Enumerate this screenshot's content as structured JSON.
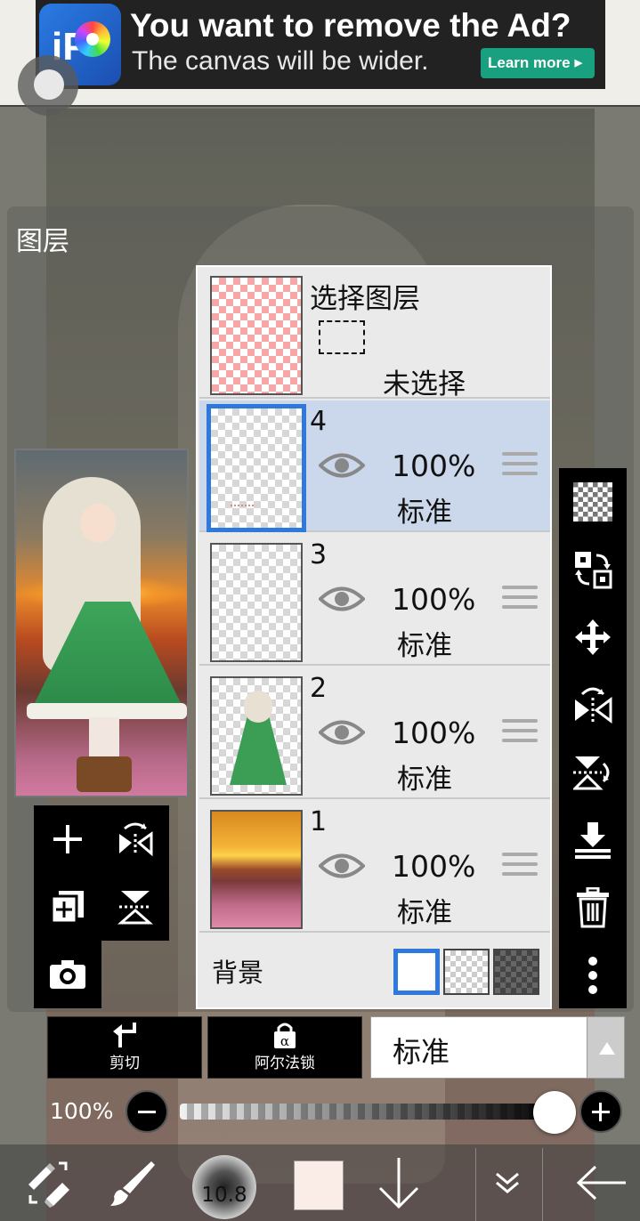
{
  "ad": {
    "title": "You want to remove the Ad?",
    "subtitle": "The canvas will be wider.",
    "button": "Learn more",
    "logo_text": "iP"
  },
  "panel": {
    "title": "图层"
  },
  "selection_layer": {
    "title": "选择图层",
    "state": "未选择"
  },
  "layers": [
    {
      "name": "4",
      "opacity": "100%",
      "mode": "标准",
      "selected": true
    },
    {
      "name": "3",
      "opacity": "100%",
      "mode": "标准",
      "selected": false
    },
    {
      "name": "2",
      "opacity": "100%",
      "mode": "标准",
      "selected": false
    },
    {
      "name": "1",
      "opacity": "100%",
      "mode": "标准",
      "selected": false
    }
  ],
  "background": {
    "label": "背景",
    "options": [
      "white",
      "transparent",
      "dark-checker"
    ],
    "selected": "white"
  },
  "bottom_controls": {
    "clip_label": "剪切",
    "alpha_lock_label": "阿尔法锁",
    "blend_mode": "标准",
    "opacity_label": "100%",
    "opacity_value": 1.0
  },
  "toolbar": {
    "brush_size": "10.8",
    "color": "#faede8"
  },
  "colors": {
    "accent": "#2f78dc",
    "selected_row": "#cbd8ec",
    "ad_button": "#19a07e"
  }
}
